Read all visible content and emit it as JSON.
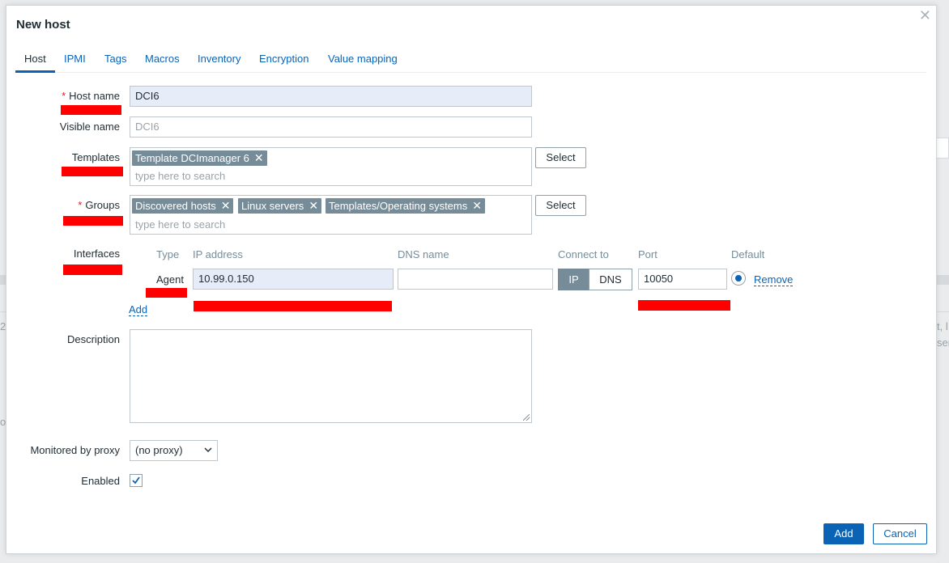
{
  "modal": {
    "title": "New host",
    "close_icon": "close-icon"
  },
  "tabs": [
    {
      "label": "Host",
      "active": true
    },
    {
      "label": "IPMI"
    },
    {
      "label": "Tags"
    },
    {
      "label": "Macros"
    },
    {
      "label": "Inventory"
    },
    {
      "label": "Encryption"
    },
    {
      "label": "Value mapping"
    }
  ],
  "form": {
    "host_name": {
      "label": "Host name",
      "value": "DCI6",
      "required": true
    },
    "visible_name": {
      "label": "Visible name",
      "placeholder": "DCI6"
    },
    "templates": {
      "label": "Templates",
      "chips": [
        "Template DCImanager 6"
      ],
      "placeholder": "type here to search",
      "select_label": "Select"
    },
    "groups": {
      "label": "Groups",
      "required": true,
      "chips": [
        "Discovered hosts",
        "Linux servers",
        "Templates/Operating systems"
      ],
      "placeholder": "type here to search",
      "select_label": "Select"
    },
    "interfaces": {
      "label": "Interfaces",
      "headers": {
        "type": "Type",
        "ip": "IP address",
        "dns": "DNS name",
        "connect": "Connect to",
        "port": "Port",
        "default": "Default"
      },
      "rows": [
        {
          "type": "Agent",
          "ip": "10.99.0.150",
          "dns": "",
          "connect_ip": "IP",
          "connect_dns": "DNS",
          "connect_selected": "IP",
          "port": "10050",
          "remove_label": "Remove"
        }
      ],
      "add_label": "Add"
    },
    "description": {
      "label": "Description",
      "value": ""
    },
    "proxy": {
      "label": "Monitored by proxy",
      "value": "(no proxy)"
    },
    "enabled": {
      "label": "Enabled",
      "checked": true
    }
  },
  "footer": {
    "add_label": "Add",
    "cancel_label": "Cancel"
  },
  "background": {
    "fragment_left": "2",
    "fragment_right_1": "t, l",
    "fragment_right_2": "ser",
    "fragment_left_2": "oi"
  },
  "colors": {
    "accent": "#0b63b6",
    "chip": "#768d99",
    "required": "#e01b24",
    "redaction": "#ff0000"
  }
}
